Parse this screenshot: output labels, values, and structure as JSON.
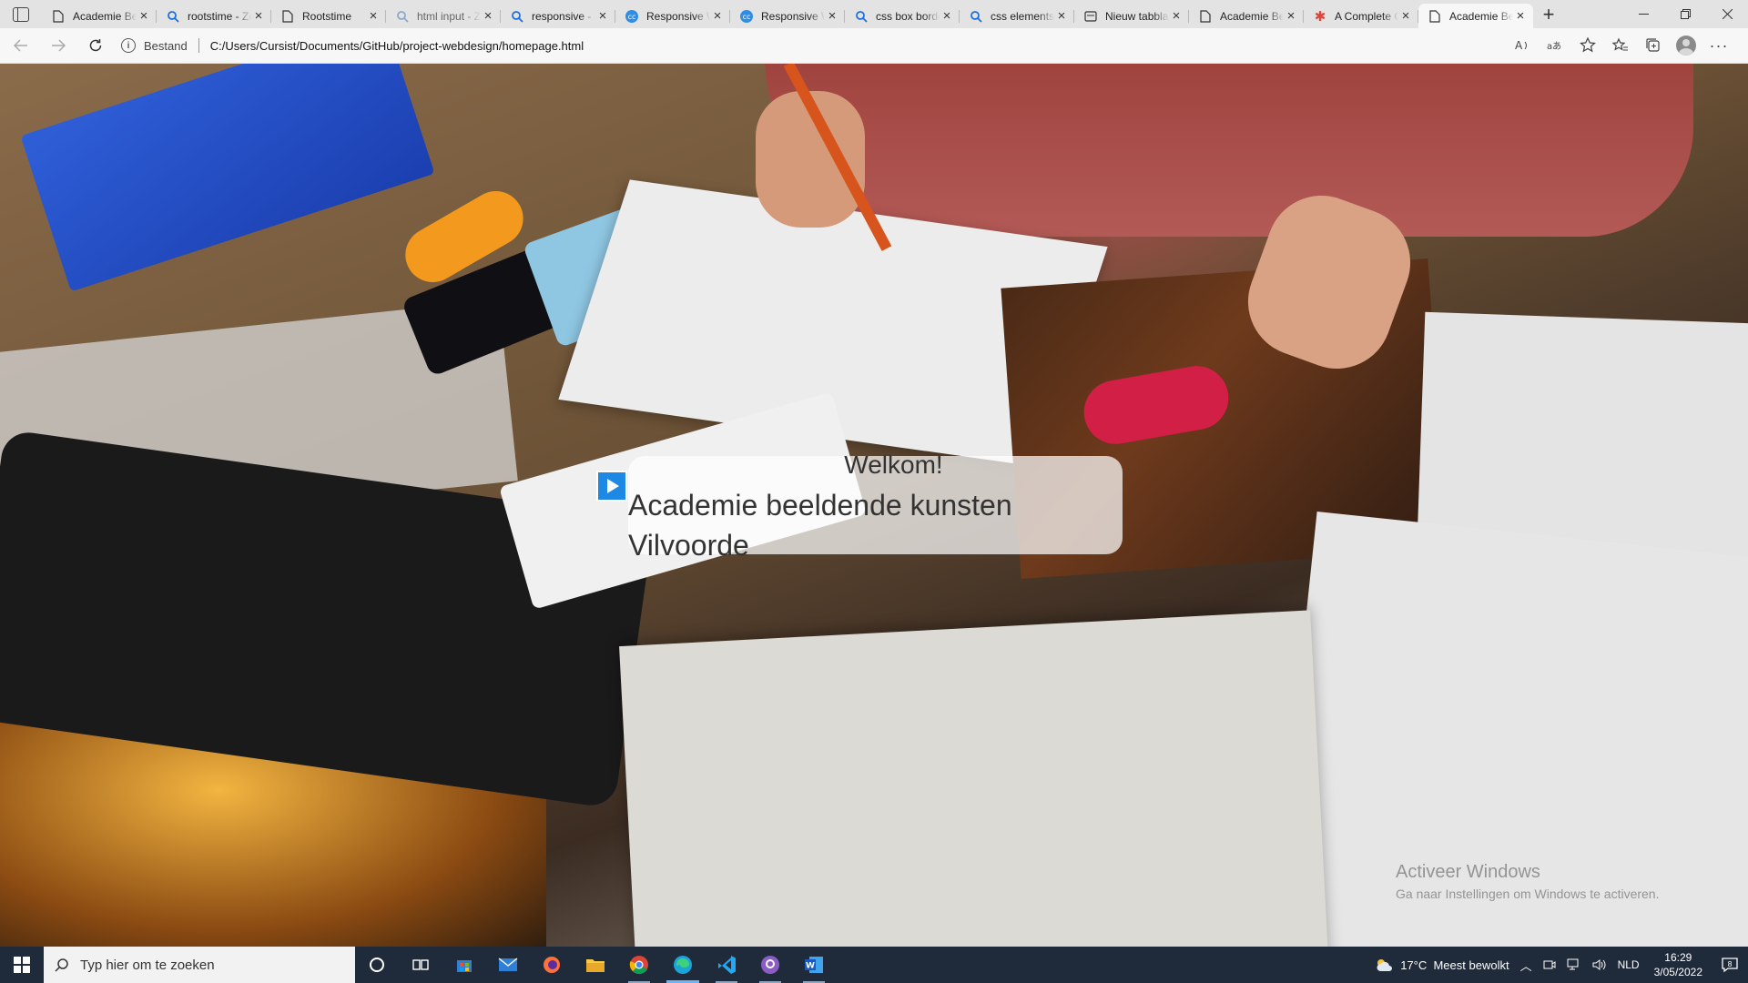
{
  "browser": {
    "tabs": [
      {
        "title": "Academie Beeldende",
        "icon": "page-icon",
        "active": false
      },
      {
        "title": "rootstime - Zoeken",
        "icon": "search-icon",
        "active": false
      },
      {
        "title": "Rootstime",
        "icon": "page-icon",
        "active": false
      },
      {
        "title": "html input - Zoeken",
        "icon": "search-icon-faded",
        "active": false
      },
      {
        "title": "responsive - Zoeken",
        "icon": "search-icon",
        "active": false
      },
      {
        "title": "Responsive Web",
        "icon": "css-icon",
        "active": false
      },
      {
        "title": "Responsive Web",
        "icon": "css-icon",
        "active": false
      },
      {
        "title": "css box border",
        "icon": "search-icon",
        "active": false
      },
      {
        "title": "css elements",
        "icon": "search-icon",
        "active": false
      },
      {
        "title": "Nieuw tabblad",
        "icon": "newtab-icon",
        "active": false
      },
      {
        "title": "Academie Beeldende",
        "icon": "page-icon",
        "active": false
      },
      {
        "title": "A Complete Guide",
        "icon": "star-icon",
        "active": false
      },
      {
        "title": "Academie Beeldende",
        "icon": "page-icon",
        "active": true
      }
    ],
    "site_label": "Bestand",
    "url": "C:/Users/Cursist/Documents/GitHub/project-webdesign/homepage.html"
  },
  "page": {
    "welcome_title": "Welkom!",
    "welcome_subtitle": "Academie beeldende kunsten Vilvoorde"
  },
  "watermark": {
    "title": "Activeer Windows",
    "subtitle": "Ga naar Instellingen om Windows te activeren."
  },
  "taskbar": {
    "search_placeholder": "Typ hier om te zoeken",
    "apps": [
      "cortana-icon",
      "task-view-icon",
      "store-icon",
      "mail-icon",
      "firefox-icon",
      "file-explorer-icon",
      "chrome-icon",
      "edge-icon",
      "vscode-icon",
      "github-icon",
      "word-icon"
    ],
    "weather": "17°C  Meest bewolkt",
    "language": "NLD",
    "time": "16:29",
    "date": "3/05/2022",
    "notification_count": "8"
  },
  "colors": {
    "accent_blue": "#1e88e5",
    "taskbar": "#1f2a3a"
  }
}
